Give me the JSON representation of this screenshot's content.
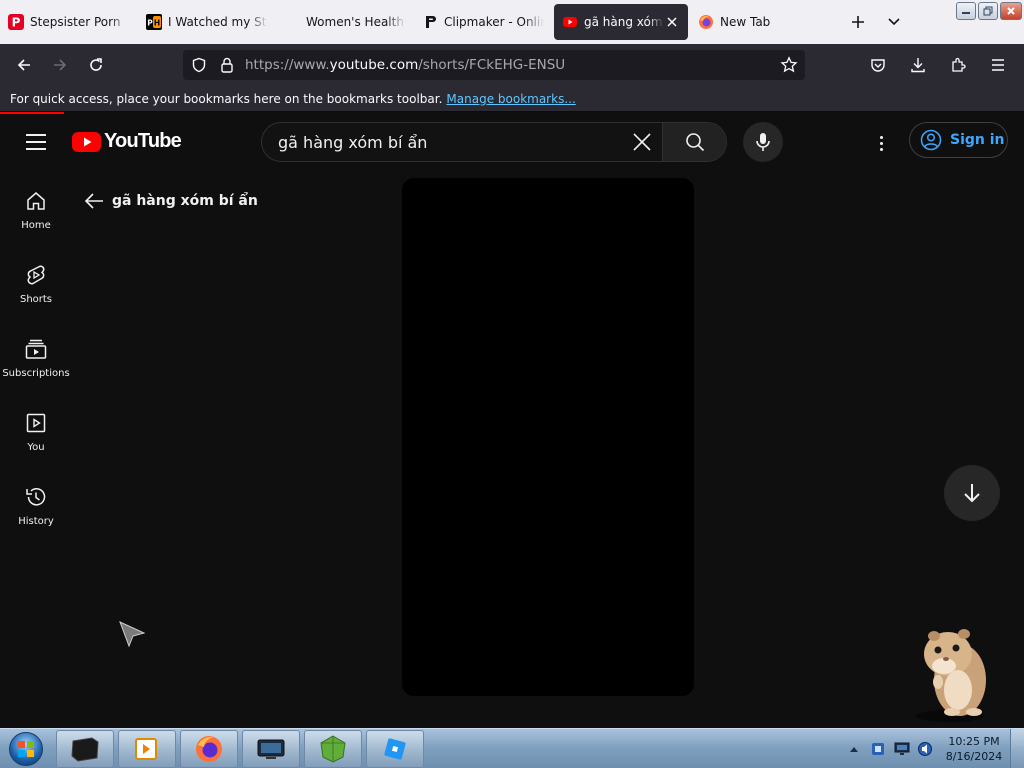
{
  "browser": {
    "tabs": [
      {
        "label": "Stepsister Porn",
        "favicon": "pinterest-icon",
        "active": false
      },
      {
        "label": "I Watched my Ste",
        "favicon": "ph-icon",
        "active": false
      },
      {
        "label": "Women's Health - Sup",
        "favicon": "",
        "active": false
      },
      {
        "label": "Clipmaker - Onlin",
        "favicon": "clipmaker-icon",
        "active": false
      },
      {
        "label": "gã hàng xóm b",
        "favicon": "youtube-icon",
        "active": true
      },
      {
        "label": "New Tab",
        "favicon": "firefox-icon",
        "active": false
      }
    ],
    "url": {
      "scheme": "https://www.",
      "host": "youtube.com",
      "path": "/shorts/FCkEHG-ENSU"
    },
    "bookmarks_bar": {
      "message": "For quick access, place your bookmarks here on the bookmarks toolbar.",
      "manage_link": "Manage bookmarks..."
    }
  },
  "youtube": {
    "logo_text": "YouTube",
    "search_query": "gã hàng xóm bí ẩn",
    "sign_in_label": "Sign in",
    "sidebar": [
      {
        "label": "Home",
        "icon": "home-icon"
      },
      {
        "label": "Shorts",
        "icon": "shorts-icon"
      },
      {
        "label": "Subscriptions",
        "icon": "subscriptions-icon"
      },
      {
        "label": "You",
        "icon": "you-icon"
      },
      {
        "label": "History",
        "icon": "history-icon"
      }
    ],
    "page_title": "gã hàng xóm bí ẩn"
  },
  "taskbar": {
    "clock_time": "10:25 PM",
    "clock_date": "8/16/2024",
    "pinned": [
      "terminal-app-icon",
      "media-player-icon",
      "firefox-icon",
      "display-app-icon",
      "minecraft-icon",
      "roblox-icon"
    ]
  },
  "colors": {
    "youtube_red": "#ff0000",
    "link_blue": "#3ea6ff",
    "browser_chrome": "#2b2a33"
  }
}
